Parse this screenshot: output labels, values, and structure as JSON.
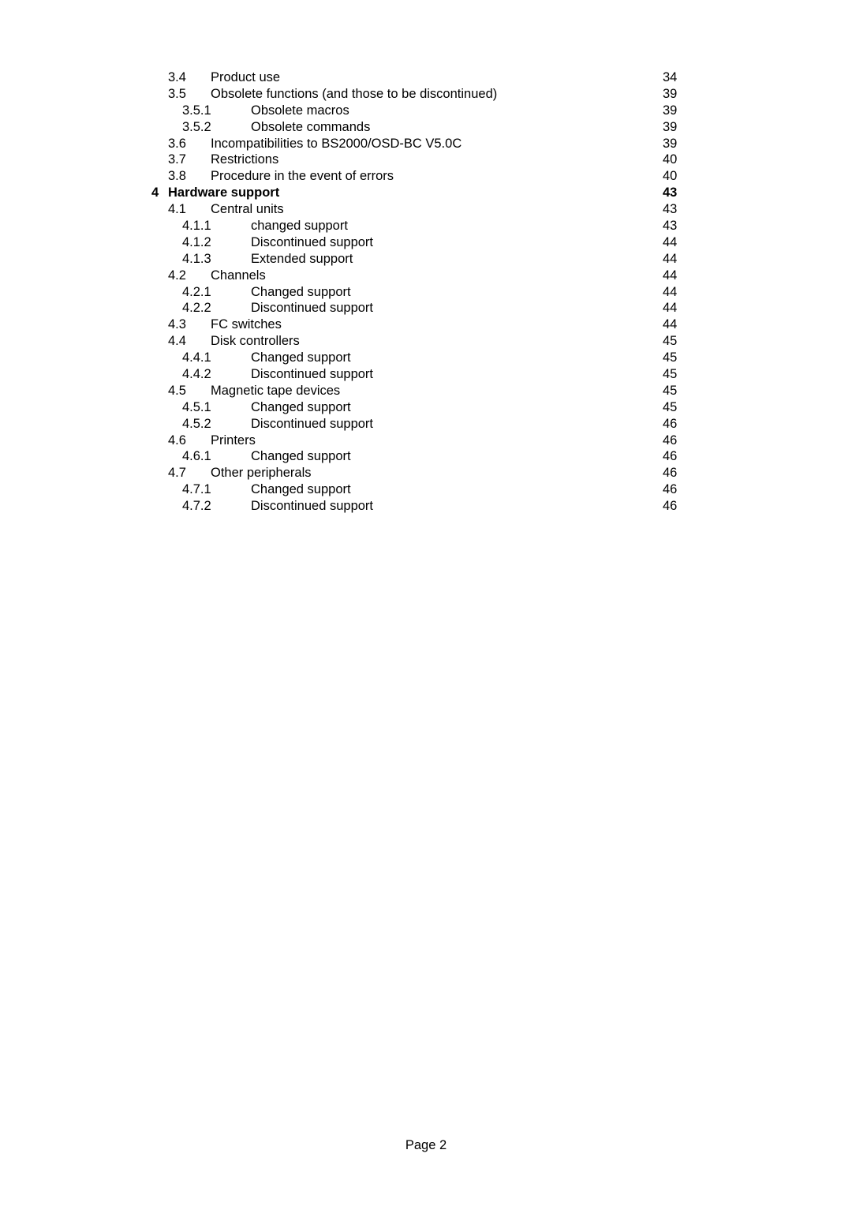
{
  "document": {
    "page_label": "Page 2"
  },
  "toc": {
    "entries": [
      {
        "number": "3.4",
        "title": "Product use",
        "page": "34",
        "level": 2,
        "bold": false
      },
      {
        "number": "3.5",
        "title": "Obsolete functions (and those to be discontinued)",
        "page": "39",
        "level": 2,
        "bold": false
      },
      {
        "number": "3.5.1",
        "title": "Obsolete macros",
        "page": "39",
        "level": 3,
        "bold": false
      },
      {
        "number": "3.5.2",
        "title": "Obsolete commands",
        "page": "39",
        "level": 3,
        "bold": false
      },
      {
        "number": "3.6",
        "title": "Incompatibilities to BS2000/OSD-BC V5.0C",
        "page": "39",
        "level": 2,
        "bold": false
      },
      {
        "number": "3.7",
        "title": "Restrictions",
        "page": "40",
        "level": 2,
        "bold": false
      },
      {
        "number": "3.8",
        "title": "Procedure in the event of errors",
        "page": "40",
        "level": 2,
        "bold": false
      },
      {
        "number": "4",
        "title": "Hardware support",
        "page": "43",
        "level": 1,
        "bold": true
      },
      {
        "number": "4.1",
        "title": "Central units",
        "page": "43",
        "level": 2,
        "bold": false
      },
      {
        "number": "4.1.1",
        "title": "changed support",
        "page": "43",
        "level": 3,
        "bold": false
      },
      {
        "number": "4.1.2",
        "title": "Discontinued support",
        "page": "44",
        "level": 3,
        "bold": false
      },
      {
        "number": "4.1.3",
        "title": "Extended support",
        "page": "44",
        "level": 3,
        "bold": false
      },
      {
        "number": "4.2",
        "title": "Channels",
        "page": "44",
        "level": 2,
        "bold": false
      },
      {
        "number": "4.2.1",
        "title": "Changed support",
        "page": "44",
        "level": 3,
        "bold": false
      },
      {
        "number": "4.2.2",
        "title": "Discontinued support",
        "page": "44",
        "level": 3,
        "bold": false
      },
      {
        "number": "4.3",
        "title": "FC switches",
        "page": "44",
        "level": 2,
        "bold": false
      },
      {
        "number": "4.4",
        "title": "Disk controllers",
        "page": "45",
        "level": 2,
        "bold": false
      },
      {
        "number": "4.4.1",
        "title": "Changed support",
        "page": "45",
        "level": 3,
        "bold": false
      },
      {
        "number": "4.4.2",
        "title": "Discontinued support",
        "page": "45",
        "level": 3,
        "bold": false
      },
      {
        "number": "4.5",
        "title": "Magnetic tape devices",
        "page": "45",
        "level": 2,
        "bold": false
      },
      {
        "number": "4.5.1",
        "title": "Changed support",
        "page": "45",
        "level": 3,
        "bold": false
      },
      {
        "number": "4.5.2",
        "title": "Discontinued support",
        "page": "46",
        "level": 3,
        "bold": false
      },
      {
        "number": "4.6",
        "title": "Printers",
        "page": "46",
        "level": 2,
        "bold": false
      },
      {
        "number": "4.6.1",
        "title": "Changed support",
        "page": "46",
        "level": 3,
        "bold": false
      },
      {
        "number": "4.7",
        "title": "Other peripherals",
        "page": "46",
        "level": 2,
        "bold": false
      },
      {
        "number": "4.7.1",
        "title": "Changed support",
        "page": "46",
        "level": 3,
        "bold": false
      },
      {
        "number": "4.7.2",
        "title": "Discontinued support",
        "page": "46",
        "level": 3,
        "bold": false
      }
    ]
  }
}
